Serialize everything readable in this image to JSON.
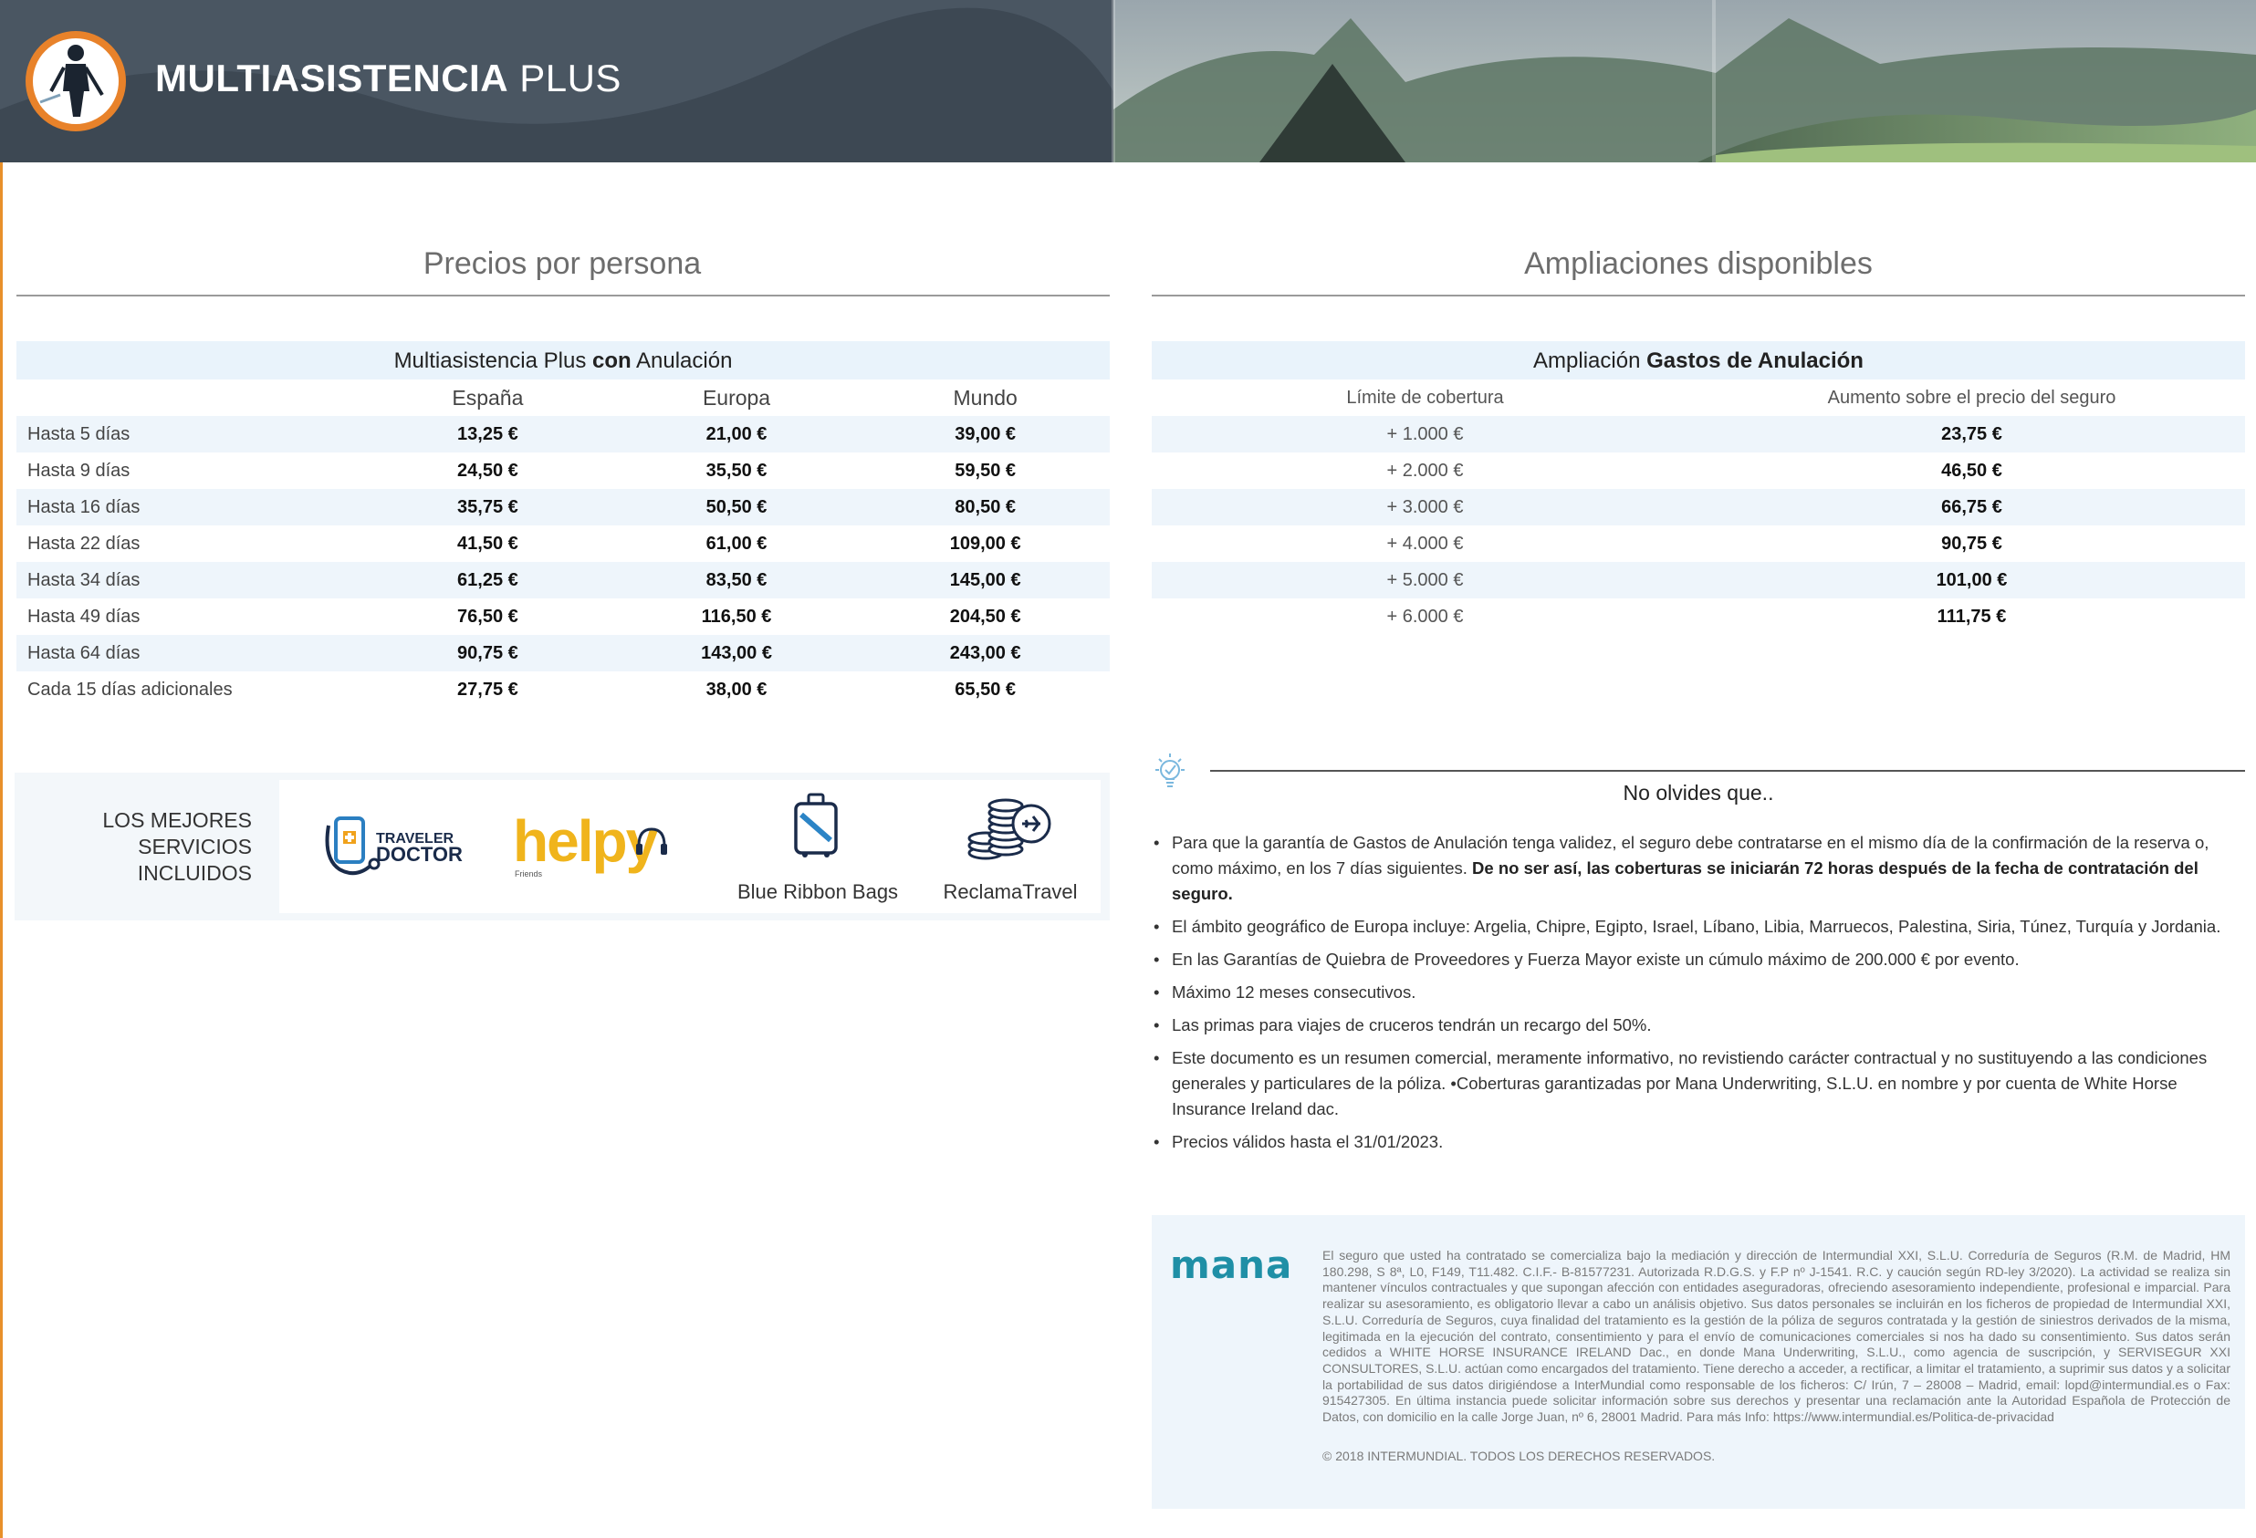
{
  "header": {
    "brand_bold": "MULTIASISTENCIA",
    "brand_light": "PLUS"
  },
  "left": {
    "title": "Precios por persona",
    "table": {
      "caption_pre": "Multiasistencia Plus ",
      "caption_bold": "con",
      "caption_post": " Anulación",
      "columns": [
        "España",
        "Europa",
        "Mundo"
      ],
      "rows": [
        {
          "label": "Hasta 5 días",
          "values": [
            "13,25 €",
            "21,00 €",
            "39,00 €"
          ]
        },
        {
          "label": "Hasta 9 días",
          "values": [
            "24,50 €",
            "35,50 €",
            "59,50 €"
          ]
        },
        {
          "label": "Hasta 16 días",
          "values": [
            "35,75 €",
            "50,50 €",
            "80,50 €"
          ]
        },
        {
          "label": "Hasta 22 días",
          "values": [
            "41,50 €",
            "61,00 €",
            "109,00 €"
          ]
        },
        {
          "label": "Hasta 34 días",
          "values": [
            "61,25 €",
            "83,50 €",
            "145,00 €"
          ]
        },
        {
          "label": "Hasta 49 días",
          "values": [
            "76,50 €",
            "116,50 €",
            "204,50 €"
          ]
        },
        {
          "label": "Hasta 64 días",
          "values": [
            "90,75 €",
            "143,00 €",
            "243,00 €"
          ]
        },
        {
          "label": "Cada 15 días adicionales",
          "values": [
            "27,75 €",
            "38,00 €",
            "65,50 €"
          ]
        }
      ]
    }
  },
  "right": {
    "title": "Ampliaciones disponibles",
    "table": {
      "caption_pre": "Ampliación ",
      "caption_bold": "Gastos de Anulación",
      "columns": [
        "Límite de cobertura",
        "Aumento sobre el precio del seguro"
      ],
      "rows": [
        {
          "limit": "+ 1.000 €",
          "increase": "23,75 €"
        },
        {
          "limit": "+ 2.000 €",
          "increase": "46,50 €"
        },
        {
          "limit": "+ 3.000 €",
          "increase": "66,75 €"
        },
        {
          "limit": "+ 4.000 €",
          "increase": "90,75 €"
        },
        {
          "limit": "+ 5.000 €",
          "increase": "101,00 €"
        },
        {
          "limit": "+ 6.000 €",
          "increase": "111,75 €"
        }
      ]
    }
  },
  "services": {
    "label_lines": [
      "LOS MEJORES",
      "SERVICIOS",
      "INCLUIDOS"
    ],
    "traveler_top": "TRAVELER",
    "traveler_bottom": "DOCTOR",
    "helpy": "helpy",
    "helpy_sub": "Friends",
    "bags": "Blue Ribbon Bags",
    "reclama": "ReclamaTravel"
  },
  "notes": {
    "title": "No olvides que..",
    "items": [
      {
        "text": "Para que la garantía de Gastos de Anulación tenga validez, el seguro debe contratarse en el mismo día de la confirmación de la reserva o, como máximo, en los 7 días siguientes. ",
        "bold": "De no ser así, las coberturas se iniciarán 72 horas después de la fecha de contratación del seguro."
      },
      {
        "text": "El ámbito geográfico de Europa incluye: Argelia, Chipre, Egipto, Israel, Líbano, Libia, Marruecos, Palestina, Siria, Túnez, Turquía y Jordania.",
        "bold": ""
      },
      {
        "text": "En las Garantías de Quiebra de Proveedores y Fuerza Mayor existe un cúmulo máximo de 200.000 € por evento.",
        "bold": ""
      },
      {
        "text": "Máximo 12 meses consecutivos.",
        "bold": ""
      },
      {
        "text": "Las primas para viajes de cruceros tendrán un recargo del 50%.",
        "bold": ""
      },
      {
        "text": "Este documento es un resumen comercial, meramente informativo, no revistiendo carácter contractual y no sustituyendo a las condiciones generales y particulares de la póliza. •Coberturas garantizadas por Mana Underwriting, S.L.U. en nombre y por cuenta de White Horse Insurance Ireland dac.",
        "bold": ""
      },
      {
        "text": "Precios válidos hasta el 31/01/2023.",
        "bold": ""
      }
    ]
  },
  "legal": {
    "logo": "mana",
    "text": "El seguro que usted ha contratado se comercializa bajo la mediación y dirección de Intermundial XXI, S.L.U. Correduría de Seguros (R.M. de Madrid, HM 180.298, S 8ª, L0, F149, T11.482. C.I.F.- B-81577231. Autorizada R.D.G.S. y F.P nº J-1541. R.C. y caución según RD-ley 3/2020). La actividad se realiza sin mantener vínculos contractuales y que supongan afección con entidades aseguradoras, ofreciendo asesoramiento independiente, profesional e imparcial. Para realizar su asesoramiento, es obligatorio llevar a cabo un análisis objetivo. Sus datos personales se incluirán en los ficheros de propiedad de Intermundial XXI, S.L.U. Correduría de Seguros, cuya finalidad del tratamiento es la gestión de la póliza de seguros contratada y la gestión de siniestros derivados de la misma, legitimada en la ejecución del contrato, consentimiento y para el envío de comunicaciones comerciales si nos ha dado su consentimiento. Sus datos serán cedidos a WHITE HORSE INSURANCE IRELAND Dac., en donde Mana Underwriting, S.L.U., como agencia de suscripción, y SERVISEGUR XXI CONSULTORES, S.L.U. actúan como encargados del tratamiento. Tiene derecho a acceder, a rectificar, a limitar el tratamiento, a suprimir sus datos y a solicitar la portabilidad de sus datos dirigiéndose a InterMundial como responsable de los ficheros: C/ Irún, 7 – 28008 – Madrid, email: lopd@intermundial.es o Fax: 915427305. En última instancia puede solicitar información sobre sus derechos y presentar una reclamación ante la Autoridad Española de Protección de Datos, con domicilio en la calle Jorge Juan, nº 6, 28001 Madrid. Para más Info: https://www.intermundial.es/Politica-de-privacidad",
    "copyright": "© 2018 INTERMUNDIAL. TODOS LOS DERECHOS RESERVADOS."
  },
  "colors": {
    "accent_orange": "#e8822a",
    "table_band": "#e9f3fb",
    "helpy_yellow": "#f0b41c",
    "mana_teal": "#1f8fa6",
    "bags_blue": "#2b84c6"
  }
}
